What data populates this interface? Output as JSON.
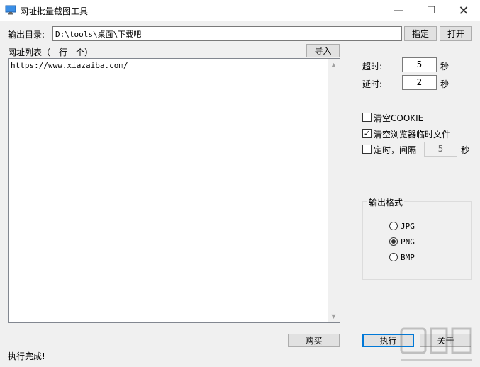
{
  "window": {
    "title": "网址批量截图工具",
    "min_glyph": "—",
    "max_glyph": "☐",
    "close_glyph": "✕"
  },
  "output_dir": {
    "label": "输出目录:",
    "value": "D:\\tools\\桌面\\下载吧",
    "specify_label": "指定",
    "open_label": "打开"
  },
  "url_list": {
    "label": "网址列表（一行一个）",
    "import_label": "导入",
    "content": "https://www.xiazaiba.com/"
  },
  "timeout": {
    "label": "超时:",
    "value": "5",
    "unit": "秒"
  },
  "delay": {
    "label": "延时:",
    "value": "2",
    "unit": "秒"
  },
  "options": {
    "clear_cookie": {
      "label": "清空COOKIE",
      "checked": false
    },
    "clear_temp": {
      "label": "清空浏览器临时文件",
      "checked": true
    },
    "timer": {
      "label": "定时，间隔",
      "checked": false,
      "value": "5",
      "unit": "秒"
    }
  },
  "format": {
    "title": "输出格式",
    "options": [
      "JPG",
      "PNG",
      "BMP"
    ],
    "selected": "PNG"
  },
  "buttons": {
    "buy": "购买",
    "execute": "执行",
    "about": "关于"
  },
  "status": "执行完成!",
  "colors": {
    "accent": "#0078d7",
    "background": "#f0f0f0"
  }
}
